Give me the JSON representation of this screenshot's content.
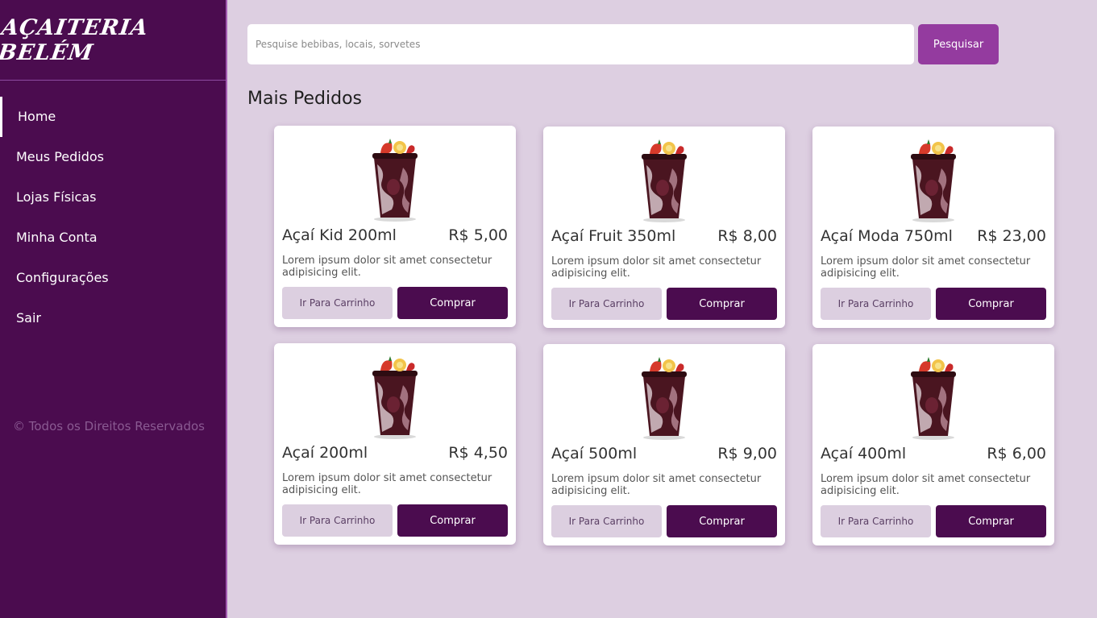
{
  "brand": {
    "name": "AÇAITERIA BELÉM"
  },
  "sidebar": {
    "items": [
      {
        "label": "Home",
        "active": true
      },
      {
        "label": "Meus Pedidos"
      },
      {
        "label": "Lojas Físicas"
      },
      {
        "label": "Minha Conta"
      },
      {
        "label": "Configurações"
      },
      {
        "label": "Sair"
      }
    ],
    "copyright": "© Todos os Direitos Reservados"
  },
  "search": {
    "placeholder": "Pesquise bebibas, locais, sorvetes",
    "value": "",
    "button_label": "Pesquisar"
  },
  "main": {
    "section_title": "Mais Pedidos",
    "products": [
      {
        "name": "Açaí Kid 200ml",
        "price": "R$ 5,00",
        "description": "Lorem ipsum dolor sit amet consectetur adipisicing elit.",
        "cart_label": "Ir Para Carrinho",
        "buy_label": "Comprar"
      },
      {
        "name": "Açaí Fruit 350ml",
        "price": "R$ 8,00",
        "description": "Lorem ipsum dolor sit amet consectetur adipisicing elit.",
        "cart_label": "Ir Para Carrinho",
        "buy_label": "Comprar"
      },
      {
        "name": "Açaí Moda 750ml",
        "price": "R$ 23,00",
        "description": "Lorem ipsum dolor sit amet consectetur adipisicing elit.",
        "cart_label": "Ir Para Carrinho",
        "buy_label": "Comprar"
      },
      {
        "name": "Açaí 200ml",
        "price": "R$ 4,50",
        "description": "Lorem ipsum dolor sit amet consectetur adipisicing elit.",
        "cart_label": "Ir Para Carrinho",
        "buy_label": "Comprar"
      },
      {
        "name": "Açaí 500ml",
        "price": "R$ 9,00",
        "description": "Lorem ipsum dolor sit amet consectetur adipisicing elit.",
        "cart_label": "Ir Para Carrinho",
        "buy_label": "Comprar"
      },
      {
        "name": "Açaí 400ml",
        "price": "R$ 6,00",
        "description": "Lorem ipsum dolor sit amet consectetur adipisicing elit.",
        "cart_label": "Ir Para Carrinho",
        "buy_label": "Comprar"
      }
    ]
  },
  "colors": {
    "sidebar_bg": "#4b0c4f",
    "page_bg": "#ddcfe1",
    "accent": "#943b9f",
    "cart_button_bg": "#dccfe0"
  }
}
